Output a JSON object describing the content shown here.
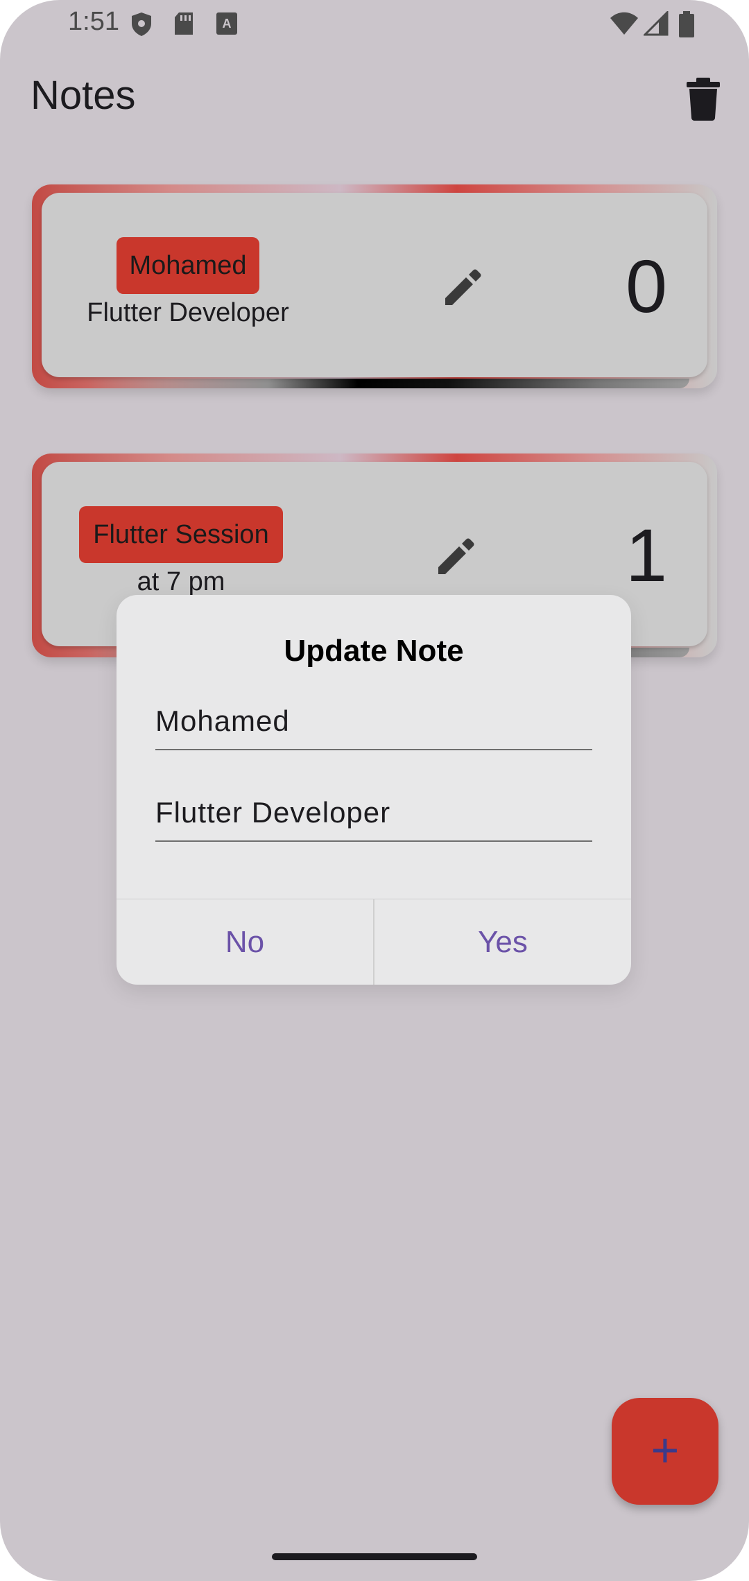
{
  "status_bar": {
    "time": "1:51",
    "left_icons": [
      "shield-icon",
      "sd-card-icon",
      "keyboard-a-icon"
    ],
    "right_icons": [
      "wifi-icon",
      "signal-icon",
      "battery-icon"
    ]
  },
  "app_bar": {
    "title": "Notes",
    "action_icon": "trash-icon"
  },
  "notes": [
    {
      "title": "Mohamed",
      "subtitle": "Flutter Developer",
      "index": "0",
      "action_icon": "edit-icon"
    },
    {
      "title": "Flutter Session",
      "subtitle": "at 7 pm",
      "index": "1",
      "action_icon": "edit-icon"
    }
  ],
  "dialog": {
    "title": "Update Note",
    "fields": [
      {
        "value": "Mohamed"
      },
      {
        "value": "Flutter Developer"
      }
    ],
    "cancel_label": "No",
    "confirm_label": "Yes"
  },
  "fab": {
    "label": "+",
    "icon": "add-icon"
  },
  "colors": {
    "background": "#cbc5cb",
    "accent_red": "#c9372c",
    "card": "#cacaca",
    "dialog": "#e8e8e9",
    "dialog_button_text": "#6b52a8",
    "fab_glyph": "#3b3a8a"
  }
}
